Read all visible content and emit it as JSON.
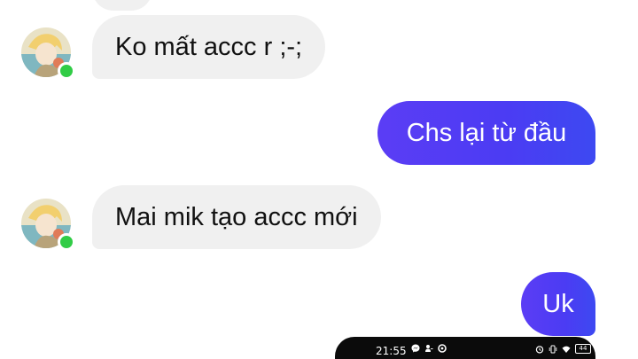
{
  "messages": [
    {
      "id": "m1",
      "side": "incoming",
      "text": "Ko mất accc r ;-;"
    },
    {
      "id": "m2",
      "side": "outgoing",
      "text": "Chs lại từ đầu"
    },
    {
      "id": "m3",
      "side": "incoming",
      "text": "Mai mik tạo accc mới"
    },
    {
      "id": "m4",
      "side": "outgoing",
      "text": "Uk"
    }
  ],
  "status_bar": {
    "time": "21:55",
    "battery": "44"
  },
  "colors": {
    "incoming_bubble": "#f0f0f0",
    "outgoing_bubble": "#4b3cf3",
    "online_dot": "#31cc46"
  },
  "icons": {
    "left": [
      "messenger-icon",
      "person-icon",
      "circle-icon"
    ],
    "right": [
      "alarm-icon",
      "vibrate-icon",
      "wifi-icon",
      "battery-icon"
    ]
  }
}
